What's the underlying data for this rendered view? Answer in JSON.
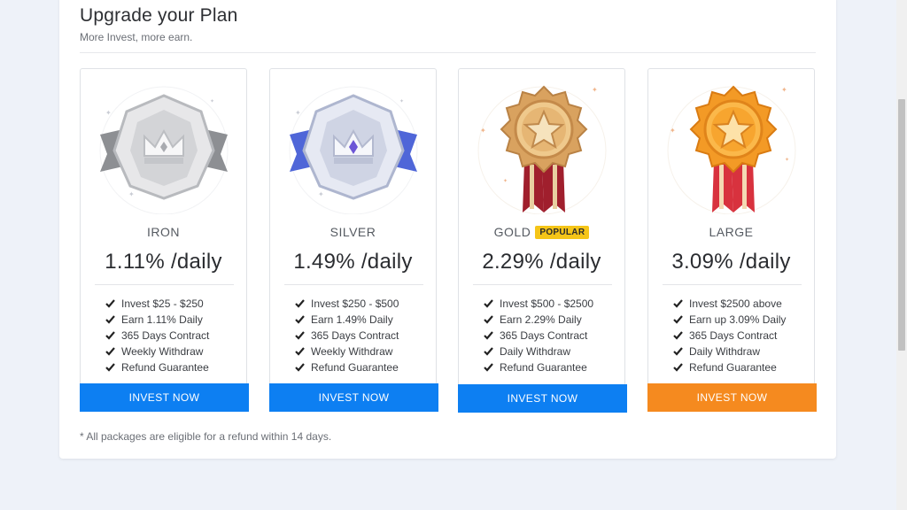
{
  "header": {
    "title": "Upgrade your Plan",
    "subtitle": "More Invest, more earn."
  },
  "plans": [
    {
      "name": "IRON",
      "rate": "1.11% /daily",
      "features": [
        "Invest $25 - $250",
        "Earn 1.11% Daily",
        "365 Days Contract",
        "Weekly Withdraw",
        "Refund Guarantee"
      ],
      "button": "INVEST NOW",
      "button_color": "#0d7ff2",
      "medal_icon": "iron-crown-medal-icon"
    },
    {
      "name": "SILVER",
      "rate": "1.49% /daily",
      "features": [
        "Invest $250 - $500",
        "Earn 1.49% Daily",
        "365 Days Contract",
        "Weekly Withdraw",
        "Refund Guarantee"
      ],
      "button": "INVEST NOW",
      "button_color": "#0d7ff2",
      "medal_icon": "silver-crown-medal-icon"
    },
    {
      "name": "GOLD",
      "badge": "POPULAR",
      "rate": "2.29% /daily",
      "features": [
        "Invest $500 - $2500",
        "Earn 2.29% Daily",
        "365 Days Contract",
        "Daily Withdraw",
        "Refund Guarantee"
      ],
      "button": "INVEST NOW",
      "button_color": "#0d7ff2",
      "medal_icon": "gold-star-medal-icon"
    },
    {
      "name": "LARGE",
      "rate": "3.09% /daily",
      "features": [
        "Invest $2500 above",
        "Earn up 3.09% Daily",
        "365 Days Contract",
        "Daily Withdraw",
        "Refund Guarantee"
      ],
      "button": "INVEST NOW",
      "button_color": "#f58a1f",
      "medal_icon": "orange-star-medal-icon"
    }
  ],
  "footnote": "* All packages are eligible for a refund within 14 days.",
  "colors": {
    "accent_blue": "#0d7ff2",
    "accent_orange": "#f58a1f",
    "badge_yellow": "#f5c518",
    "page_bg": "#eef2f9"
  }
}
